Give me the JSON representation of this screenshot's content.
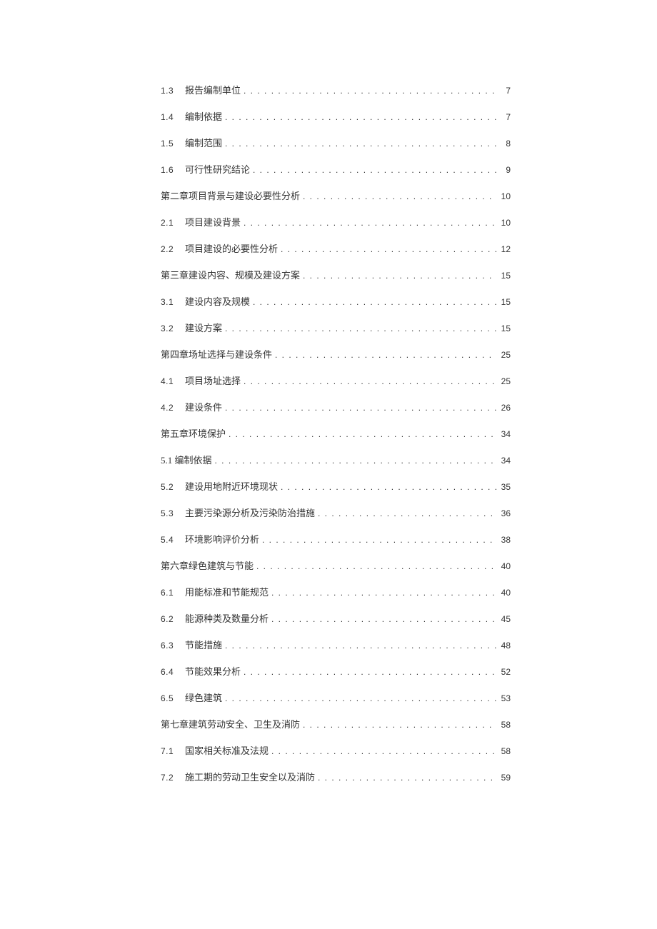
{
  "toc": [
    {
      "num": "1.3",
      "title": "报告编制单位",
      "page": "7",
      "kind": "section"
    },
    {
      "num": "1.4",
      "title": "编制依据",
      "page": "7",
      "kind": "section"
    },
    {
      "num": "1.5",
      "title": "编制范围",
      "page": "8",
      "kind": "section"
    },
    {
      "num": "1.6",
      "title": "可行性研究结论",
      "page": "9",
      "kind": "section"
    },
    {
      "num": "",
      "title": "第二章项目背景与建设必要性分析",
      "page": "10",
      "kind": "chapter"
    },
    {
      "num": "2.1",
      "title": "项目建设背景",
      "page": "10",
      "kind": "section"
    },
    {
      "num": "2.2",
      "title": "项目建设的必要性分析",
      "page": "12",
      "kind": "section"
    },
    {
      "num": "",
      "title": "第三章建设内容、规模及建设方案",
      "page": "15",
      "kind": "chapter"
    },
    {
      "num": "3.1",
      "title": "建设内容及规模",
      "page": "15",
      "kind": "section"
    },
    {
      "num": "3.2",
      "title": "建设方案",
      "page": "15",
      "kind": "section"
    },
    {
      "num": "",
      "title": "第四章场址选择与建设条件",
      "page": "25",
      "kind": "chapter"
    },
    {
      "num": "4.1",
      "title": "项目场址选择",
      "page": "25",
      "kind": "section"
    },
    {
      "num": "4.2",
      "title": "建设条件",
      "page": "26",
      "kind": "section"
    },
    {
      "num": "",
      "title": "第五章环境保护",
      "page": "34",
      "kind": "chapter"
    },
    {
      "num": "",
      "title": "5.1 编制依据",
      "page": "34",
      "kind": "chapter"
    },
    {
      "num": "5.2",
      "title": "建设用地附近环境现状",
      "page": "35",
      "kind": "section"
    },
    {
      "num": "5.3",
      "title": "主要污染源分析及污染防治措施",
      "page": "36",
      "kind": "section"
    },
    {
      "num": "5.4",
      "title": "环境影响评价分析",
      "page": "38",
      "kind": "section"
    },
    {
      "num": "",
      "title": "第六章绿色建筑与节能",
      "page": "40",
      "kind": "chapter"
    },
    {
      "num": "6.1",
      "title": "用能标准和节能规范",
      "page": "40",
      "kind": "section"
    },
    {
      "num": "6.2",
      "title": "能源种类及数量分析",
      "page": "45",
      "kind": "section"
    },
    {
      "num": "6.3",
      "title": "节能措施",
      "page": "48",
      "kind": "section"
    },
    {
      "num": "6.4",
      "title": "节能效果分析",
      "page": "52",
      "kind": "section"
    },
    {
      "num": "6.5",
      "title": "绿色建筑",
      "page": "53",
      "kind": "section"
    },
    {
      "num": "",
      "title": "第七章建筑劳动安全、卫生及消防",
      "page": "58",
      "kind": "chapter"
    },
    {
      "num": "7.1",
      "title": "国家相关标准及法规",
      "page": "58",
      "kind": "section"
    },
    {
      "num": "7.2",
      "title": "施工期的劳动卫生安全以及消防",
      "page": "59",
      "kind": "section"
    }
  ]
}
